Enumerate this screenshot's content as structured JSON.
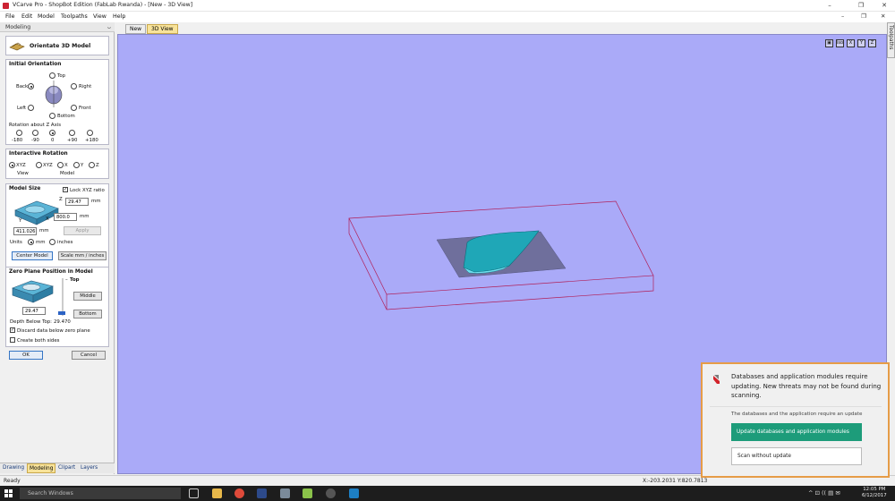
{
  "window": {
    "title": "VCarve Pro - ShopBot Edition (FabLab Rwanda) - [New - 3D View]",
    "minimize": "–",
    "restore": "❐",
    "close": "✕"
  },
  "menu": [
    "File",
    "Edit",
    "Model",
    "Toolpaths",
    "View",
    "Help"
  ],
  "menu_right": {
    "minimize": "–",
    "restore": "❐",
    "close": "✕"
  },
  "panel": {
    "header": "Modeling",
    "pin": "ᴗ",
    "tool_title": "Orientate 3D Model",
    "initial_orientation": {
      "title": "Initial Orientation",
      "top": "Top",
      "back": "Back",
      "right": "Right",
      "left": "Left",
      "front": "Front",
      "bottom": "Bottom",
      "rotation_label": "Rotation about Z Axis",
      "rotations": [
        "-180",
        "-90",
        "0",
        "+90",
        "+180"
      ]
    },
    "interactive_rotation": {
      "title": "Interactive Rotation",
      "options": [
        "XYZ",
        "XYZ",
        "X",
        "Y",
        "Z"
      ],
      "view": "View",
      "model": "Model"
    },
    "model_size": {
      "title": "Model Size",
      "lock": "Lock XYZ ratio",
      "z_value": "29.47",
      "z_unit": "mm",
      "x_label": "X",
      "x_value": "800.0",
      "x_unit": "mm",
      "y_value": "411.026",
      "y_unit": "mm",
      "z_axis": "Z",
      "y_axis": "Y",
      "apply": "Apply",
      "units_label": "Units",
      "mm": "mm",
      "inches": "inches",
      "center_model": "Center Model",
      "scale": "Scale mm / inches"
    },
    "zero_plane": {
      "title": "Zero Plane Position in Model",
      "top": "Top",
      "middle": "Middle",
      "bottom": "Bottom",
      "value": "29.47",
      "depth_label": "Depth Below Top:",
      "depth_value": "29.470",
      "discard": "Discard data below zero plane",
      "both_sides": "Create both sides"
    },
    "ok": "OK",
    "cancel": "Cancel"
  },
  "bottom_tabs": [
    "Drawing",
    "Modeling",
    "Clipart",
    "Layers"
  ],
  "doc_tabs": [
    "New",
    "3D View"
  ],
  "view_icons": [
    "▣",
    "iso",
    "X",
    "Y",
    "Z"
  ],
  "toolpaths_tab": "Toolpaths",
  "status": {
    "left": "Ready",
    "coords": "X:-203.2031 Y:820.7813"
  },
  "taskbar": {
    "search": "Search Windows",
    "tray": "^  ⊡  ((  ▤  ✉",
    "time": "12:05 PM",
    "date": "6/12/2017"
  },
  "notification": {
    "message": "Databases and application modules require updating. New threats may not be found during scanning.",
    "sub": "The databases and the application require an update",
    "primary": "Update databases and application modules",
    "secondary": "Scan without update"
  },
  "colors": {
    "viewport_bg": "#aaaaf8",
    "box_edge": "#b0205a",
    "model_fill": "#1fa7b7",
    "shadow": "#6f6f9c",
    "accent_tab": "#f8e39a",
    "notif_border": "#e69c47",
    "notif_button": "#1d9c7a"
  }
}
